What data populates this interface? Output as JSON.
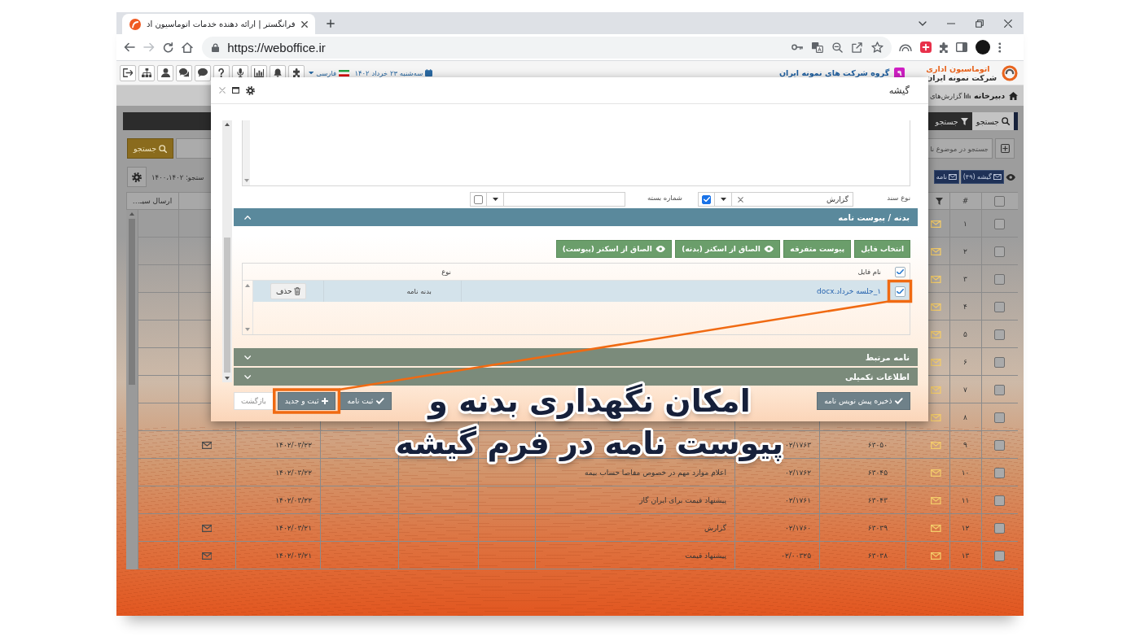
{
  "browser": {
    "tab_title": "فرانگستر | ارائه دهنده خدمات اتوماسیون اد",
    "url": "https://weboffice.ir"
  },
  "app_header": {
    "logo": {
      "title": "اتوماسیون اداری",
      "subtitle": "شرکت نمونه ایران"
    },
    "company": "گروه شرکت های نمونه ایران",
    "badge": "۹",
    "date": "سه‌شنبه ۲۳ خرداد ۱۴۰۲",
    "language": "فارسی"
  },
  "nav": [
    {
      "label": "دبیرخانه",
      "kind": "home",
      "selected": true
    },
    {
      "label": "گزارش‌های",
      "kind": "reports",
      "selected": false
    }
  ],
  "list_page": {
    "tabs": [
      {
        "label": "جستجو",
        "kind": "search",
        "selected": true
      },
      {
        "label": "جستجو",
        "kind": "filter",
        "selected": false
      }
    ],
    "search_field": {
      "placeholder": "جستجو در موضوع نا"
    },
    "search_button": "جستجو",
    "filter_summary": "ستجو: ۱۴۰۰،۱۴۰۲",
    "folders": [
      {
        "label": "گیشه (۴۹)"
      },
      {
        "label": "نامه"
      }
    ],
    "table": {
      "header": {
        "checked": false,
        "index": "#",
        "column_12": "ارسال سیـ…"
      },
      "rows": [
        {
          "checked": false,
          "index": "۱"
        },
        {
          "checked": false,
          "index": "۲"
        },
        {
          "checked": false,
          "index": "۳"
        },
        {
          "checked": false,
          "index": "۴"
        },
        {
          "checked": false,
          "index": "۵"
        },
        {
          "checked": false,
          "index": "۶"
        },
        {
          "checked": false,
          "index": "۷"
        },
        {
          "checked": false,
          "index": "۸"
        },
        {
          "checked": false,
          "index": "۹",
          "column_4": "۶۳۰۵۰",
          "column_5": "۰۲/۱۷۶۳",
          "column_10": "۱۴۰۲/۰۳/۲۲",
          "envelope": true
        },
        {
          "checked": false,
          "index": "۱۰",
          "column_4": "۶۳۰۴۵",
          "column_5": "۰۲/۱۷۶۲",
          "column_6": "اعلام موارد مهم در خصوص مفاصا حساب بیمه",
          "column_10": "۱۴۰۲/۰۳/۲۲",
          "envelope": false
        },
        {
          "checked": false,
          "index": "۱۱",
          "column_4": "۶۳۰۴۳",
          "column_5": "۰۲/۱۷۶۱",
          "column_6": "پیشنهاد قیمت برای ایران گاز",
          "column_10": "۱۴۰۲/۰۳/۲۲",
          "envelope": false
        },
        {
          "checked": false,
          "index": "۱۲",
          "column_4": "۶۳۰۳۹",
          "column_5": "۰۲/۱۷۶۰",
          "column_6": "گزارش",
          "column_10": "۱۴۰۲/۰۳/۲۱",
          "envelope": true
        },
        {
          "checked": false,
          "index": "۱۳",
          "column_4": "۶۳۰۳۸",
          "column_5": "۰۲/۰۰۳۲۵",
          "column_6": "پیشنهاد قیمت",
          "column_10": "۱۴۰۲/۰۳/۲۱",
          "envelope": true
        }
      ]
    }
  },
  "dialog": {
    "title": "گیشه",
    "fields": [
      {
        "label": "نوع سند",
        "value": "گزارش",
        "checked": true
      },
      {
        "label": "شماره بسته",
        "checked": false
      }
    ],
    "sections": [
      {
        "title": "بدنه / پیوست نامه",
        "expanded": true,
        "attachments": {
          "buttons": [
            {
              "label": "انتخاب فایل",
              "kind": "plain"
            },
            {
              "label": "پیوست متفرقه",
              "kind": "plain"
            },
            {
              "label": "الصاق از اسکنر (بدنه)",
              "kind": "scan"
            },
            {
              "label": "الصاق از اسکنر (پیوست)",
              "kind": "scan"
            }
          ],
          "header_checked": true,
          "columns": [
            {
              "label": "نام فایل"
            },
            {
              "label": "نوع"
            }
          ],
          "files": [
            {
              "name": "۱_جلسه خرداد.docx",
              "type": "بدنه نامه",
              "delete_label": "حذف",
              "checked": true,
              "selected": true,
              "highlighted": true
            }
          ]
        }
      },
      {
        "title": "نامه مرتبط",
        "expanded": false
      },
      {
        "title": "اطلاعات تکمیلی",
        "expanded": false
      }
    ],
    "draft_actions": [
      {
        "label": "ذخیره پیش نویس نامه",
        "kind": "check",
        "highlighted": false
      }
    ],
    "submit_actions": [
      {
        "label": "ثبت نامه",
        "kind": "check",
        "highlighted": false
      },
      {
        "label": "ثبت و جدید",
        "kind": "plus",
        "highlighted": true
      },
      {
        "label": "بازگشت",
        "kind": "plain",
        "highlighted": false
      }
    ]
  },
  "promo": {
    "headline": "امکان نگهداری بدنه و\nپیوست نامه در فرم گیشه"
  }
}
